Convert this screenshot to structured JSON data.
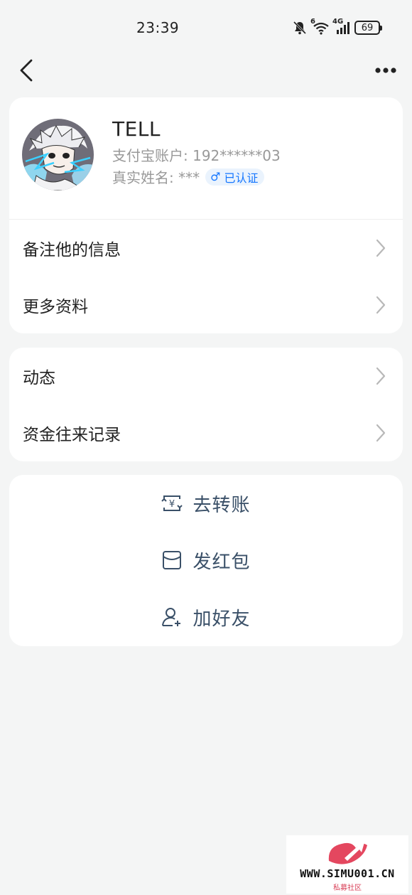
{
  "status_bar": {
    "time": "23:39",
    "network_wifi": "6",
    "network_cell": "4G",
    "battery": "69"
  },
  "nav": {
    "back_icon": "chevron-left-icon",
    "more_icon": "more-horizontal-icon"
  },
  "profile": {
    "nickname": "TELL",
    "account": "支付宝账户: 192******03",
    "real_name": "真实姓名: ***",
    "gender_symbol": "♂",
    "verified": "已认证",
    "badge_color": "#1677ff"
  },
  "menu_profile": [
    {
      "label": "备注他的信息"
    },
    {
      "label": "更多资料"
    }
  ],
  "menu_activity": [
    {
      "label": "动态"
    },
    {
      "label": "资金往来记录"
    }
  ],
  "actions": [
    {
      "label": "去转账",
      "icon": "transfer-icon"
    },
    {
      "label": "发红包",
      "icon": "red-envelope-icon"
    },
    {
      "label": "加好友",
      "icon": "add-friend-icon"
    }
  ],
  "watermark": {
    "text": "WWW.SIMU001.CN",
    "sub": "私募社区"
  },
  "colors": {
    "background": "#f4f5f5",
    "card": "#ffffff",
    "action_text": "#3a5068",
    "accent": "#1677ff"
  }
}
